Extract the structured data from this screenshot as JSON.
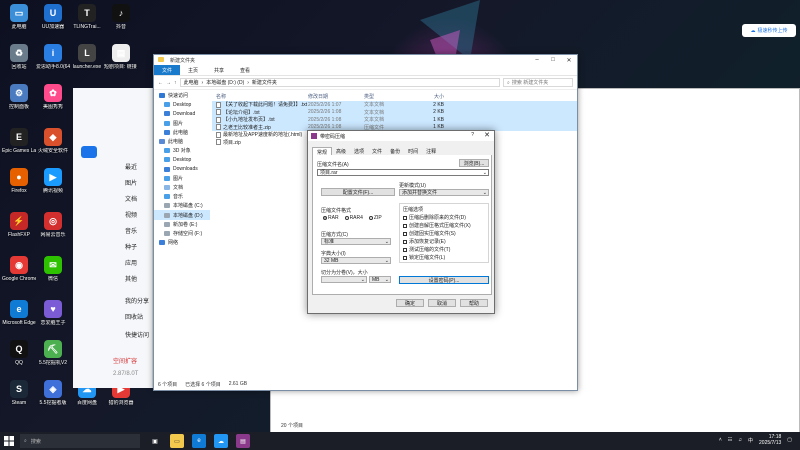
{
  "desktop": {
    "icons": [
      {
        "label": "此电脑",
        "color": "#3b8fd8",
        "glyph": "▭"
      },
      {
        "label": "UU加速器",
        "color": "#1f6fcf",
        "glyph": "U"
      },
      {
        "label": "TLINGTrai...",
        "color": "#222",
        "glyph": "T"
      },
      {
        "label": "抖音",
        "color": "#111",
        "glyph": "♪"
      },
      {
        "label": "回收站",
        "color": "#6a7b8c",
        "glyph": "♻"
      },
      {
        "label": "爱思助手8.0(64位)",
        "color": "#2a7de1",
        "glyph": "i"
      },
      {
        "label": "launcher.exe",
        "color": "#444",
        "glyph": "L"
      },
      {
        "label": "短剧项目: 链接 4",
        "color": "#eee",
        "glyph": "▤"
      },
      {
        "label": "控制面板",
        "color": "#4a7ac0",
        "glyph": "⚙"
      },
      {
        "label": "美图秀秀",
        "color": "#ff4b8b",
        "glyph": "✿"
      },
      {
        "label": "Epic Games Launcher",
        "color": "#222",
        "glyph": "E"
      },
      {
        "label": "火绒安全软件",
        "color": "#d8502c",
        "glyph": "◆"
      },
      {
        "label": "Firefox",
        "color": "#e66000",
        "glyph": "●"
      },
      {
        "label": "腾讯视频",
        "color": "#1a9bff",
        "glyph": "▶"
      },
      {
        "label": "FlashFXP",
        "color": "#c62828",
        "glyph": "⚡"
      },
      {
        "label": "网易云音乐",
        "color": "#d32f2f",
        "glyph": "◎"
      },
      {
        "label": "Google Chrome",
        "color": "#e53935",
        "glyph": "◉"
      },
      {
        "label": "微信",
        "color": "#2dc100",
        "glyph": "✉"
      },
      {
        "label": "Microsoft Edge",
        "color": "#0f7bd4",
        "glyph": "e"
      },
      {
        "label": "恋爱脑王子",
        "color": "#7b5cd6",
        "glyph": "♥"
      },
      {
        "label": "QQ",
        "color": "#111",
        "glyph": "Q"
      },
      {
        "label": "5.5挖掘机V2",
        "color": "#4caf50",
        "glyph": "⛏"
      },
      {
        "label": "Steam",
        "color": "#1b2838",
        "glyph": "S"
      },
      {
        "label": "5.5挖掘者版",
        "color": "#3f6fd8",
        "glyph": "◈"
      },
      {
        "label": "百度网盘",
        "color": "#2196f3",
        "glyph": "☁"
      },
      {
        "label": "猎豹浏览器",
        "color": "#e53935",
        "glyph": "▶"
      }
    ]
  },
  "baidu_button": {
    "label": "极速秒传上传"
  },
  "bg_app": {
    "items": [
      "最近",
      "图片",
      "文档",
      "视频",
      "音乐",
      "种子",
      "应用",
      "其他"
    ],
    "labels": {
      "upload": "上传",
      "mine": "我的分享",
      "recycle": "回收站",
      "quick": "快捷访问",
      "speed_label": "空间扩容",
      "used": "2.87/8.0T"
    }
  },
  "bg_explorer": {
    "status": "20 个项目"
  },
  "explorer": {
    "title": "新建文件夹",
    "tabs": {
      "file": "文件",
      "home": "主页",
      "share": "共享",
      "view": "查看"
    },
    "breadcrumb": [
      "此电脑",
      "本地磁盘 (D:) (D)",
      "新建文件夹"
    ],
    "search_placeholder": "搜索 新建文件夹",
    "nav": [
      {
        "label": "快速访问",
        "color": "#2f78d3",
        "sub": false,
        "sel": false
      },
      {
        "label": "Desktop",
        "color": "#4aa0e8",
        "sub": true,
        "sel": false
      },
      {
        "label": "Download",
        "color": "#3b7fd8",
        "sub": true,
        "sel": false
      },
      {
        "label": "图片",
        "color": "#4aa0e8",
        "sub": true,
        "sel": false
      },
      {
        "label": "此电脑",
        "color": "#3b7fd8",
        "sub": true,
        "sel": false
      },
      {
        "label": "此电脑",
        "color": "#5a8ad6",
        "sub": false,
        "sel": false
      },
      {
        "label": "3D 对象",
        "color": "#4aa0e8",
        "sub": true,
        "sel": false
      },
      {
        "label": "Desktop",
        "color": "#4aa0e8",
        "sub": true,
        "sel": false
      },
      {
        "label": "Downloads",
        "color": "#3b7fd8",
        "sub": true,
        "sel": false
      },
      {
        "label": "图片",
        "color": "#4aa0e8",
        "sub": true,
        "sel": false
      },
      {
        "label": "文档",
        "color": "#8ab6e6",
        "sub": true,
        "sel": false
      },
      {
        "label": "音乐",
        "color": "#4aa0e8",
        "sub": true,
        "sel": false
      },
      {
        "label": "本地磁盘 (C:)",
        "color": "#9aa6b2",
        "sub": true,
        "sel": false
      },
      {
        "label": "本地磁盘 (D:)",
        "color": "#9aa6b2",
        "sub": true,
        "sel": true
      },
      {
        "label": "新加卷 (E:)",
        "color": "#9aa6b2",
        "sub": true,
        "sel": false
      },
      {
        "label": "存储空间 (F:)",
        "color": "#9aa6b2",
        "sub": true,
        "sel": false
      },
      {
        "label": "网络",
        "color": "#3b7fd8",
        "sub": false,
        "sel": false
      }
    ],
    "columns": {
      "name": "名称",
      "date": "修改日期",
      "type": "类型",
      "size": "大小"
    },
    "files": [
      {
        "name": "【关了收起下载此问题！请免费】】.txt",
        "date": "2025/2/26 1:07",
        "type": "文本文档",
        "size": "2 KB",
        "sel": true
      },
      {
        "name": "【论坛介绍】.txt",
        "date": "2025/2/26 1:08",
        "type": "文本文档",
        "size": "2 KB",
        "sel": true
      },
      {
        "name": "【小九地址发布页】.txt",
        "date": "2025/2/26 1:08",
        "type": "文本文档",
        "size": "1 KB",
        "sel": true
      },
      {
        "name": "之老王比较准者主.zip",
        "date": "2025/2/26 1:08",
        "type": "压缩文件",
        "size": "1 KB",
        "sel": true
      },
      {
        "name": "最新地址及APP速度新的地址(.html)",
        "date": "2025/2/26 1:08",
        "type": "HTML 文件",
        "size": "",
        "sel": false
      },
      {
        "name": "项目.zip",
        "date": "",
        "type": "",
        "size": "",
        "sel": false
      }
    ],
    "status": {
      "count": "6 个项目",
      "selected": "已选择 6 个项目",
      "size": "2.61 GB"
    }
  },
  "rar": {
    "title": "带密码压缩",
    "help": "?",
    "tabs": [
      "常规",
      "高级",
      "选项",
      "文件",
      "备份",
      "时间",
      "注释"
    ],
    "archive_name_label": "压缩文件名(A)",
    "browse": "浏览(B)...",
    "archive_name": "项目.rar",
    "update_mode_label": "更新模式(U)",
    "profiles": "配置文件(F)...",
    "update_mode": "添加并替换文件",
    "format_label": "压缩文件格式",
    "formats": [
      "RAR",
      "RAR4",
      "ZIP"
    ],
    "options_label": "压缩选项",
    "options": [
      "压缩后删除原来的文件(D)",
      "创建自解压格式压缩文件(X)",
      "创建固实压缩文件(S)",
      "添加恢复记录(E)",
      "测试压缩的文件(T)",
      "锁定压缩文件(L)"
    ],
    "method_label": "压缩方式(C)",
    "method": "标准",
    "dict_label": "字典大小(I)",
    "dict": "32 MB",
    "split_label": "切分为分卷(V)，大小",
    "split_unit": "MB",
    "set_password": "设置密码(P)...",
    "ok": "确定",
    "cancel": "取消",
    "helpbtn": "帮助"
  },
  "taskbar": {
    "search": "搜索",
    "time": "17:18",
    "date": "2025/7/13"
  }
}
